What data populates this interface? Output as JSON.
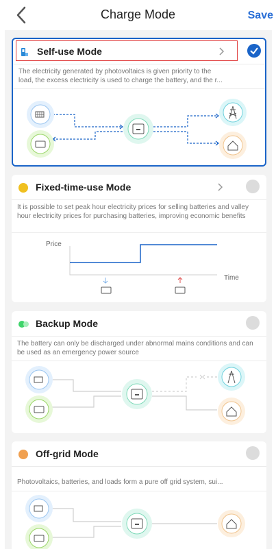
{
  "header": {
    "title": "Charge Mode",
    "save_label": "Save"
  },
  "modes": [
    {
      "name": "Self-use Mode",
      "description": "The electricity generated by photovoltaics is given priority to the load, the excess electricity is used to charge the battery, and the r...",
      "selected": true,
      "icon": "self-use-icon",
      "icon_color": "#2a8ad8"
    },
    {
      "name": "Fixed-time-use Mode",
      "description": "It is possible to set peak hour electricity prices for selling batteries and valley hour electricity prices for purchasing batteries, improving economic benefits",
      "selected": false,
      "icon": "clock-icon",
      "icon_color": "#f0c020",
      "chart": {
        "y_label": "Price",
        "x_label": "Time"
      }
    },
    {
      "name": "Backup Mode",
      "description": "The battery can only be discharged under abnormal mains conditions and can be used as an emergency power source",
      "selected": false,
      "icon": "backup-icon",
      "icon_color": "#3fd46a"
    },
    {
      "name": "Off-grid  Mode",
      "description": "Photovoltaics, batteries, and loads form a pure off grid system, sui...",
      "selected": false,
      "icon": "off-grid-icon",
      "icon_color": "#f0a050"
    }
  ],
  "colors": {
    "accent": "#1a64c8",
    "flow_active": "#1a64c8",
    "flow_inactive": "#cfcfcf",
    "highlight_box": "#e03c3c"
  }
}
